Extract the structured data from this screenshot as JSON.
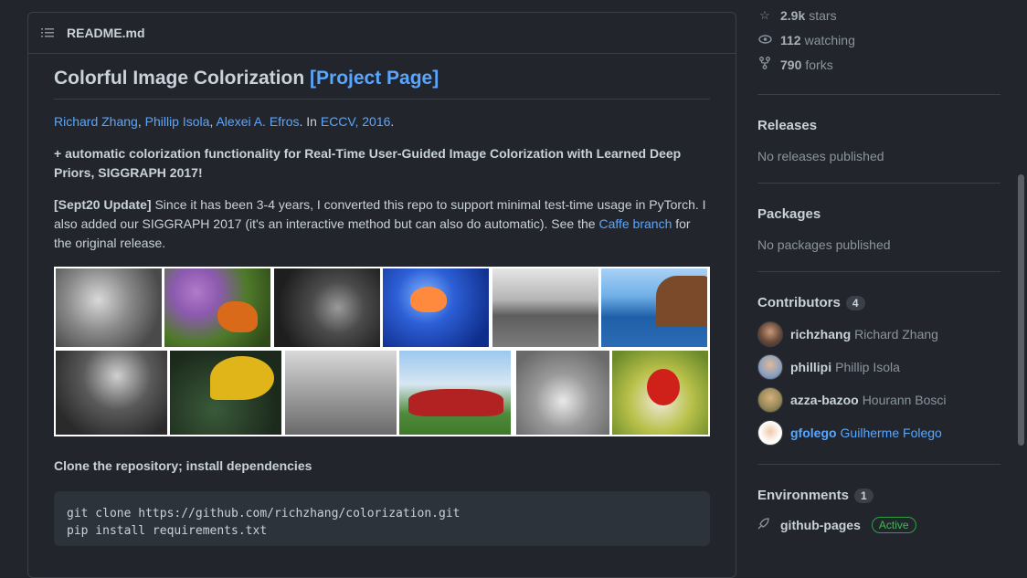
{
  "readme": {
    "filename": "README.md",
    "title": "Colorful Image Colorization ",
    "title_link": "[Project Page]",
    "authors": [
      "Richard Zhang",
      "Phillip Isola",
      "Alexei A. Efros"
    ],
    "venue_prefix": ". In ",
    "venue": "ECCV, 2016",
    "venue_suffix": ".",
    "feature_line": "+ automatic colorization functionality for Real-Time User-Guided Image Colorization with Learned Deep Priors, SIGGRAPH 2017!",
    "update_label": "[Sept20 Update]",
    "update_text": " Since it has been 3-4 years, I converted this repo to support minimal test-time usage in PyTorch. I also added our SIGGRAPH 2017 (it's an interactive method but can also do automatic). See the ",
    "caffe_link": "Caffe branch",
    "update_suffix": " for the original release.",
    "clone_heading": "Clone the repository; install dependencies",
    "code_lines": [
      "git clone https://github.com/richzhang/colorization.git",
      "pip install requirements.txt"
    ]
  },
  "sidebar": {
    "stars": {
      "value": "2.9k",
      "label": "stars"
    },
    "watching": {
      "value": "112",
      "label": "watching"
    },
    "forks": {
      "value": "790",
      "label": "forks"
    },
    "releases": {
      "title": "Releases",
      "text": "No releases published"
    },
    "packages": {
      "title": "Packages",
      "text": "No packages published"
    },
    "contributors": {
      "title": "Contributors",
      "count": "4",
      "items": [
        {
          "login": "richzhang",
          "name": "Richard Zhang"
        },
        {
          "login": "phillipi",
          "name": "Phillip Isola"
        },
        {
          "login": "azza-bazoo",
          "name": "Hourann Bosci"
        },
        {
          "login": "gfolego",
          "name": "Guilherme Folego"
        }
      ]
    },
    "environments": {
      "title": "Environments",
      "count": "1",
      "name": "github-pages",
      "status": "Active"
    }
  },
  "colors": {
    "link": "#58a6ff",
    "background": "#22262c",
    "active": "#3fb950"
  },
  "icons": [
    "list-icon",
    "star-icon",
    "eye-icon",
    "fork-icon",
    "rocket-icon"
  ]
}
